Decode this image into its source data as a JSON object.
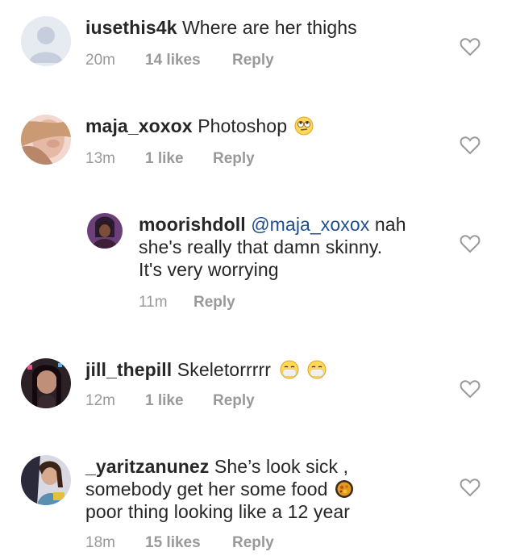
{
  "comments": [
    {
      "username": "iusethis4k",
      "text": "Where are her thighs",
      "time": "20m",
      "likes": "14 likes",
      "reply": "Reply",
      "avatar": "default-avatar-icon"
    },
    {
      "username": "maja_xoxox",
      "text": "Photoshop",
      "emoji": "eye-roll-emoji",
      "time": "13m",
      "likes": "1 like",
      "reply": "Reply",
      "avatar": "user-photo"
    },
    {
      "username": "moorishdoll",
      "mention": "@maja_xoxox",
      "text_line1": "nah",
      "text_line2": "she's really that damn skinny.",
      "text_line3": "It's very worrying",
      "time": "11m",
      "reply": "Reply",
      "avatar": "user-photo"
    },
    {
      "username": "jill_thepill",
      "text": "Skeletorrrrr",
      "emoji": "face-with-medical-mask-emoji",
      "time": "12m",
      "likes": "1 like",
      "reply": "Reply",
      "avatar": "user-photo"
    },
    {
      "username": "_yaritzanunez",
      "text_line1": "She’s look sick ,",
      "text_line2": "somebody get her some food",
      "text_line3": "poor thing looking like a 12 year",
      "emoji": "food-emoji",
      "time": "18m",
      "likes": "15 likes",
      "reply": "Reply",
      "avatar": "user-photo"
    }
  ],
  "colors": {
    "text": "#262626",
    "meta": "#999999",
    "mention": "#1f4f8b",
    "heart_outline": "#999999"
  }
}
